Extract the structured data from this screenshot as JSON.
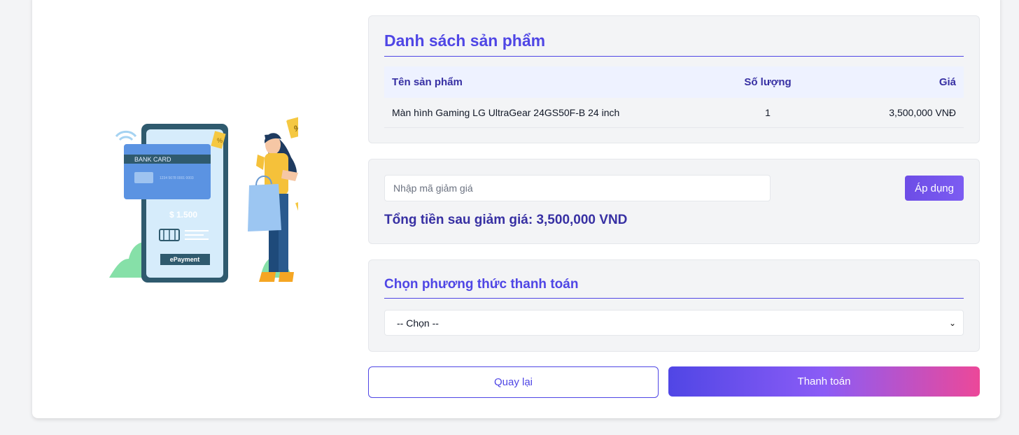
{
  "illustration": {
    "card_label": "BANK CARD",
    "card_number": "1234 5678 0001 0003",
    "amount": "$ 1.500",
    "pay_label": "ePayment",
    "percent_tag": "%",
    "dollar_tag": "$"
  },
  "products": {
    "title": "Danh sách sản phẩm",
    "columns": [
      "Tên sản phẩm",
      "Số lượng",
      "Giá"
    ],
    "rows": [
      {
        "name": "Màn hình Gaming LG UltraGear 24GS50F-B 24 inch",
        "qty": "1",
        "price": "3,500,000 VNĐ"
      }
    ]
  },
  "coupon": {
    "placeholder": "Nhập mã giảm giá",
    "value": "",
    "apply_label": "Áp dụng",
    "total_text": "Tổng tiền sau giảm giá: 3,500,000 VND"
  },
  "payment": {
    "title": "Chọn phương thức thanh toán",
    "selected": "-- Chọn --"
  },
  "actions": {
    "back_label": "Quay lại",
    "pay_label": "Thanh toán"
  },
  "colors": {
    "accent": "#4f46e5",
    "gradient_end": "#ec4899",
    "panel_bg": "#f3f4f6"
  }
}
